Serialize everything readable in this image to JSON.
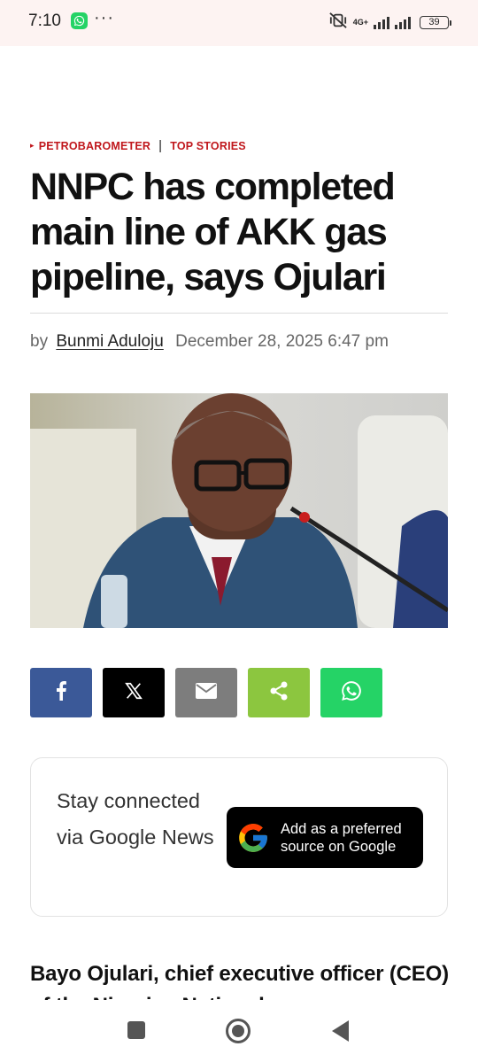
{
  "status_bar": {
    "time": "7:10",
    "network": "4G+",
    "battery": "39",
    "more": "···",
    "icons": [
      "whatsapp-notification-icon",
      "mute-vibrate-icon",
      "signal-icon",
      "battery-icon"
    ]
  },
  "article": {
    "categories": [
      "PETROBAROMETER",
      "TOP STORIES"
    ],
    "title": "NNPC has completed main line of AKK gas pipeline, says Ojulari",
    "byline_prefix": "by",
    "author": "Bunmi Aduloju",
    "date": "December 28, 2025 6:47 pm",
    "lead": "Bayo Ojulari, chief executive officer (CEO) of the Nigerian National"
  },
  "share": {
    "buttons": [
      {
        "name": "facebook",
        "color": "#3b5998"
      },
      {
        "name": "x",
        "color": "#000000"
      },
      {
        "name": "email",
        "color": "#7d7d7d"
      },
      {
        "name": "share",
        "color": "#8cc63f"
      },
      {
        "name": "whatsapp",
        "color": "#25d366"
      }
    ]
  },
  "google_news": {
    "text": "Stay connected via Google News",
    "button_label": "Add as a preferred source on Google"
  },
  "colors": {
    "accent_red": "#c0171c",
    "status_bar_bg": "#fdf3f2"
  }
}
